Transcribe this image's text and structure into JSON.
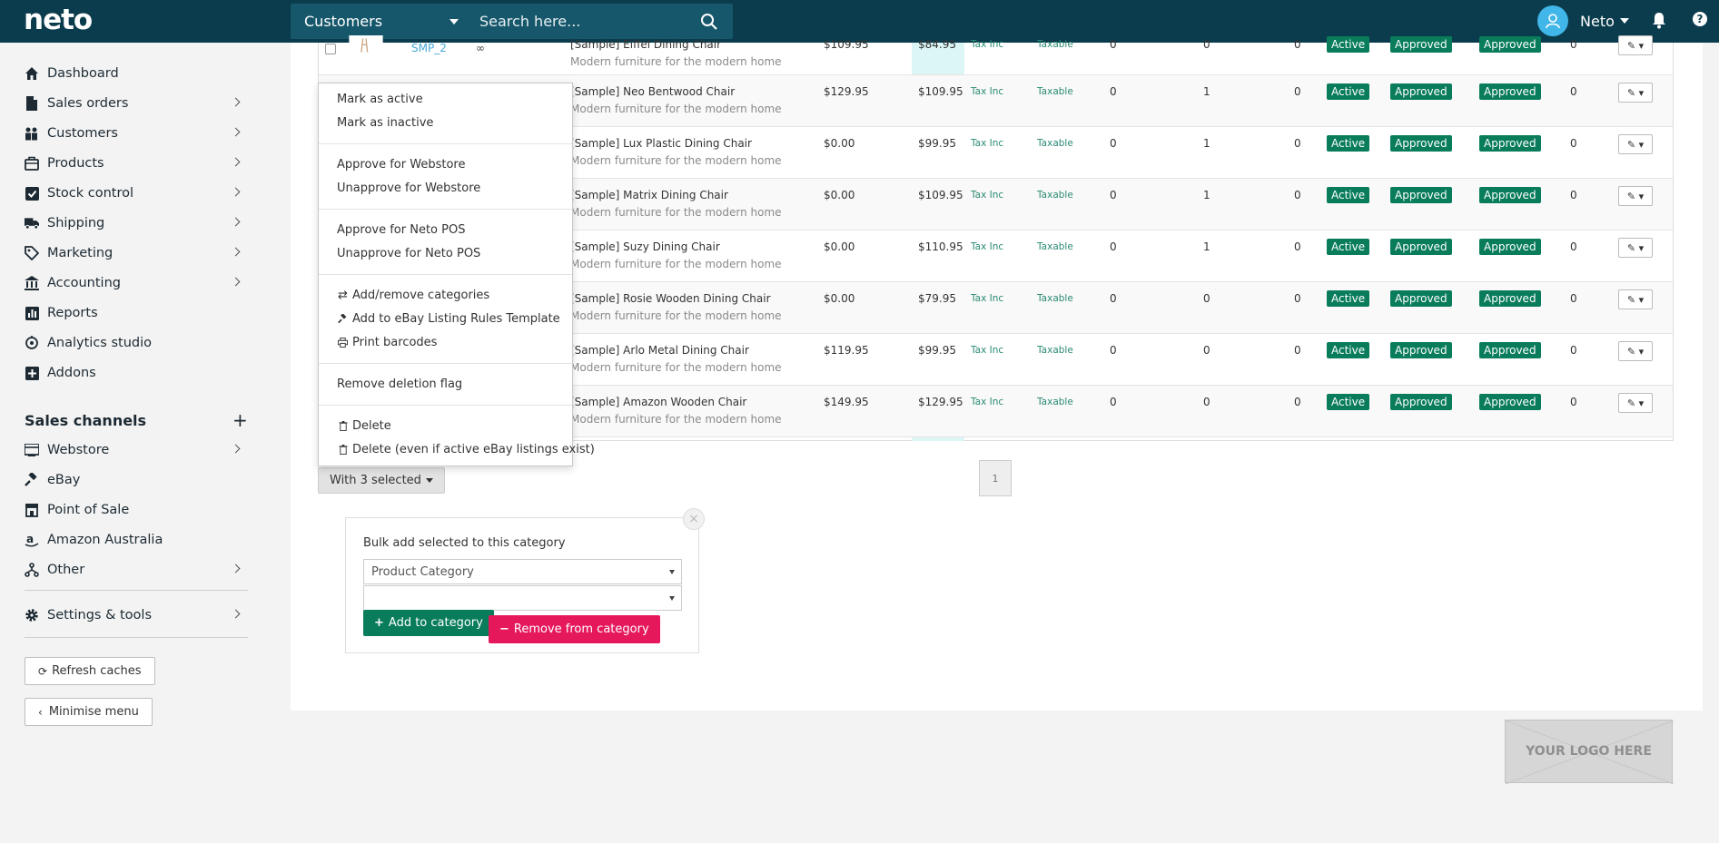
{
  "header": {
    "logo": "neto",
    "search_type": "Customers",
    "search_placeholder": "Search here...",
    "user_name": "Neto"
  },
  "sidebar": {
    "items": [
      {
        "label": "Dashboard",
        "icon": "home-icon"
      },
      {
        "label": "Sales orders",
        "icon": "document-icon"
      },
      {
        "label": "Customers",
        "icon": "users-icon"
      },
      {
        "label": "Products",
        "icon": "box-icon"
      },
      {
        "label": "Stock control",
        "icon": "checkbox-icon"
      },
      {
        "label": "Shipping",
        "icon": "truck-icon"
      },
      {
        "label": "Marketing",
        "icon": "tag-icon"
      },
      {
        "label": "Accounting",
        "icon": "bank-icon"
      },
      {
        "label": "Reports",
        "icon": "chart-icon"
      },
      {
        "label": "Analytics studio",
        "icon": "analytics-icon"
      },
      {
        "label": "Addons",
        "icon": "plus-square-icon"
      }
    ],
    "sales_channels_title": "Sales channels",
    "channels": [
      {
        "label": "Webstore",
        "icon": "globe-icon"
      },
      {
        "label": "eBay",
        "icon": "gavel-icon"
      },
      {
        "label": "Point of Sale",
        "icon": "store-icon"
      },
      {
        "label": "Amazon Australia",
        "icon": "amazon-icon"
      },
      {
        "label": "Other",
        "icon": "branch-icon"
      }
    ],
    "settings_label": "Settings & tools",
    "refresh_label": "Refresh caches",
    "minimise_label": "Minimise menu"
  },
  "table": {
    "top_row": {
      "sku": "SMP_2",
      "name": "[Sample] Eiffel Dining Chair",
      "desc": "Modern furniture for the modern home",
      "rrp": "$109.95",
      "price": "$84.95",
      "tax": "Tax Inc",
      "taxable": "Taxable",
      "q1": "0",
      "q2": "0",
      "q3": "0",
      "status": "Active",
      "approved1": "Approved",
      "approved2": "Approved",
      "q4": "0"
    },
    "rows": [
      {
        "name": "[Sample] Neo Bentwood Chair",
        "desc": "Modern furniture for the modern home",
        "rrp": "$129.95",
        "price": "$109.95",
        "tax": "Tax Inc",
        "taxable": "Taxable",
        "q1": "0",
        "q2": "1",
        "q3": "0",
        "status": "Active",
        "approved1": "Approved",
        "approved2": "Approved",
        "q4": "0"
      },
      {
        "name": "[Sample] Lux Plastic Dining Chair",
        "desc": "Modern furniture for the modern home",
        "rrp": "$0.00",
        "price": "$99.95",
        "tax": "Tax Inc",
        "taxable": "Taxable",
        "q1": "0",
        "q2": "1",
        "q3": "0",
        "status": "Active",
        "approved1": "Approved",
        "approved2": "Approved",
        "q4": "0"
      },
      {
        "name": "[Sample] Matrix Dining Chair",
        "desc": "Modern furniture for the modern home",
        "rrp": "$0.00",
        "price": "$109.95",
        "tax": "Tax Inc",
        "taxable": "Taxable",
        "q1": "0",
        "q2": "1",
        "q3": "0",
        "status": "Active",
        "approved1": "Approved",
        "approved2": "Approved",
        "q4": "0"
      },
      {
        "name": "[Sample] Suzy Dining Chair",
        "desc": "Modern furniture for the modern home",
        "rrp": "$0.00",
        "price": "$110.95",
        "tax": "Tax Inc",
        "taxable": "Taxable",
        "q1": "0",
        "q2": "1",
        "q3": "0",
        "status": "Active",
        "approved1": "Approved",
        "approved2": "Approved",
        "q4": "0"
      },
      {
        "name": "[Sample] Rosie Wooden Dining Chair",
        "desc": "Modern furniture for the modern home",
        "rrp": "$0.00",
        "price": "$79.95",
        "tax": "Tax Inc",
        "taxable": "Taxable",
        "q1": "0",
        "q2": "0",
        "q3": "0",
        "status": "Active",
        "approved1": "Approved",
        "approved2": "Approved",
        "q4": "0"
      },
      {
        "name": "[Sample] Arlo Metal Dining Chair",
        "desc": "Modern furniture for the modern home",
        "rrp": "$119.95",
        "price": "$99.95",
        "tax": "Tax Inc",
        "taxable": "Taxable",
        "q1": "0",
        "q2": "0",
        "q3": "0",
        "status": "Active",
        "approved1": "Approved",
        "approved2": "Approved",
        "q4": "0"
      },
      {
        "name": "[Sample] Amazon Wooden Chair",
        "desc": "Modern furniture for the modern home",
        "rrp": "$149.95",
        "price": "$129.95",
        "tax": "Tax Inc",
        "taxable": "Taxable",
        "q1": "0",
        "q2": "0",
        "q3": "0",
        "status": "Active",
        "approved1": "Approved",
        "approved2": "Approved",
        "q4": "0"
      }
    ],
    "page_number": "1"
  },
  "bulk_actions": {
    "button_label": "With 3 selected",
    "menu": {
      "mark_active": "Mark as active",
      "mark_inactive": "Mark as inactive",
      "approve_webstore": "Approve for Webstore",
      "unapprove_webstore": "Unapprove for Webstore",
      "approve_pos": "Approve for Neto POS",
      "unapprove_pos": "Unapprove for Neto POS",
      "add_remove_categories": "Add/remove categories",
      "add_ebay_template": "Add to eBay Listing Rules Template",
      "print_barcodes": "Print barcodes",
      "remove_deletion_flag": "Remove deletion flag",
      "delete": "Delete",
      "delete_force": "Delete (even if active eBay listings exist)"
    }
  },
  "bulk_category": {
    "label": "Bulk add selected to this category",
    "category_select": "Product Category",
    "subcategory_select": "",
    "add_label": "Add to category",
    "remove_label": "Remove from category"
  },
  "footer": {
    "logo_placeholder": "YOUR LOGO HERE"
  },
  "colors": {
    "topbar": "#0b3c4d",
    "accent_green": "#097c5c",
    "accent_pink": "#e5185c",
    "avatar": "#40b6e9"
  }
}
